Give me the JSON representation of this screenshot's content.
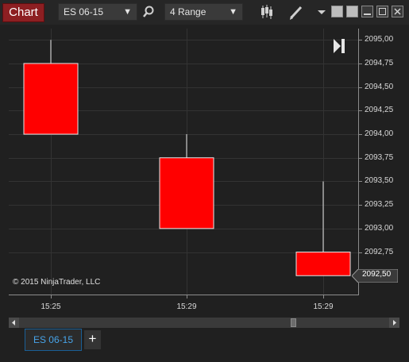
{
  "toolbar": {
    "chart_label": "Chart",
    "instrument": "ES 06-15",
    "bar_type": "4 Range",
    "icons": [
      "search-icon",
      "candlestick-icon",
      "pencil-icon",
      "dropdown-icon",
      "tile-icon",
      "minimize-icon",
      "maximize-icon",
      "close-icon"
    ]
  },
  "chart_data": {
    "type": "candlestick",
    "instrument": "ES 06-15",
    "ylim": [
      2092.3,
      2095.12
    ],
    "y_ticks": [
      "2095,00",
      "2094,75",
      "2094,50",
      "2094,25",
      "2094,00",
      "2093,75",
      "2093,50",
      "2093,25",
      "2093,00",
      "2092,75"
    ],
    "y_tick_values": [
      2095.0,
      2094.75,
      2094.5,
      2094.25,
      2094.0,
      2093.75,
      2093.5,
      2093.25,
      2093.0,
      2092.75
    ],
    "x_labels": [
      "15:25",
      "15:29",
      "15:29"
    ],
    "bars": [
      {
        "open": 2094.75,
        "high": 2095.0,
        "low": 2094.0,
        "close": 2094.0,
        "color": "#ff0000"
      },
      {
        "open": 2093.75,
        "high": 2094.0,
        "low": 2093.0,
        "close": 2093.0,
        "color": "#ff0000"
      },
      {
        "open": 2092.75,
        "high": 2093.5,
        "low": 2092.5,
        "close": 2092.5,
        "color": "#ff0000"
      }
    ],
    "last_price": "2092,50",
    "last_price_value": 2092.5,
    "copyright": "© 2015 NinjaTrader, LLC",
    "grid": true
  },
  "tabs": [
    {
      "label": "ES 06-15",
      "active": true
    }
  ],
  "add_tab_label": "+",
  "colors": {
    "background": "#202020",
    "candle": "#ff0000",
    "accent": "#47a3e8",
    "chart_button": "#8d1f22"
  }
}
